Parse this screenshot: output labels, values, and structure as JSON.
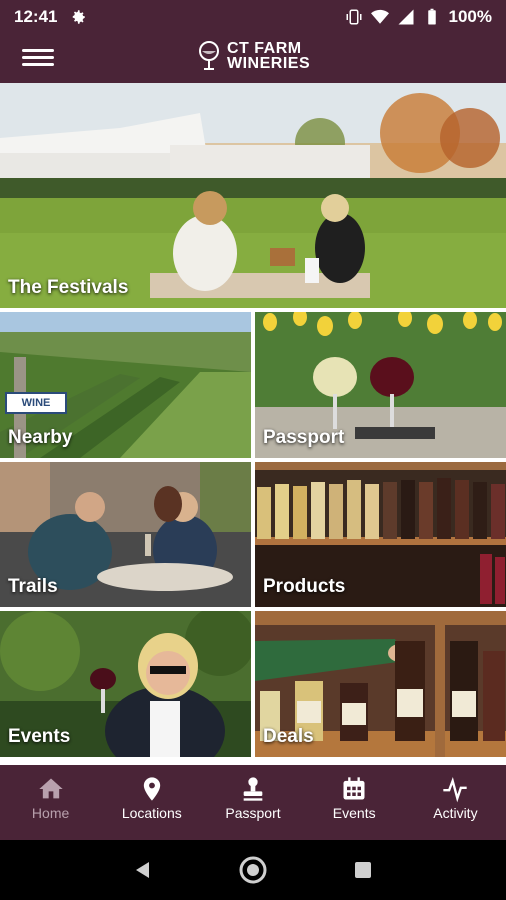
{
  "status_bar": {
    "time": "12:41",
    "battery_percent": "100%",
    "icons": [
      "gear-icon",
      "vibrate-icon",
      "wifi-icon",
      "signal-icon",
      "battery-icon"
    ]
  },
  "app_bar": {
    "logo_line1": "CT FARM",
    "logo_line2": "WINERIES",
    "menu_icon": "hamburger-icon"
  },
  "tiles": [
    {
      "label": "The Festivals"
    },
    {
      "label": "Nearby"
    },
    {
      "label": "Passport"
    },
    {
      "label": "Trails"
    },
    {
      "label": "Products"
    },
    {
      "label": "Events"
    },
    {
      "label": "Deals"
    }
  ],
  "nearby_sign": "WINE",
  "bottom_nav": [
    {
      "label": "Home",
      "icon": "home-icon",
      "active": true
    },
    {
      "label": "Locations",
      "icon": "location-pin-icon",
      "active": false
    },
    {
      "label": "Passport",
      "icon": "stamp-icon",
      "active": false
    },
    {
      "label": "Events",
      "icon": "calendar-icon",
      "active": false
    },
    {
      "label": "Activity",
      "icon": "activity-icon",
      "active": false
    }
  ],
  "colors": {
    "brand": "#4a2437",
    "nav_inactive_text": "#ffffff",
    "nav_active_text": "#b8a0ad"
  }
}
